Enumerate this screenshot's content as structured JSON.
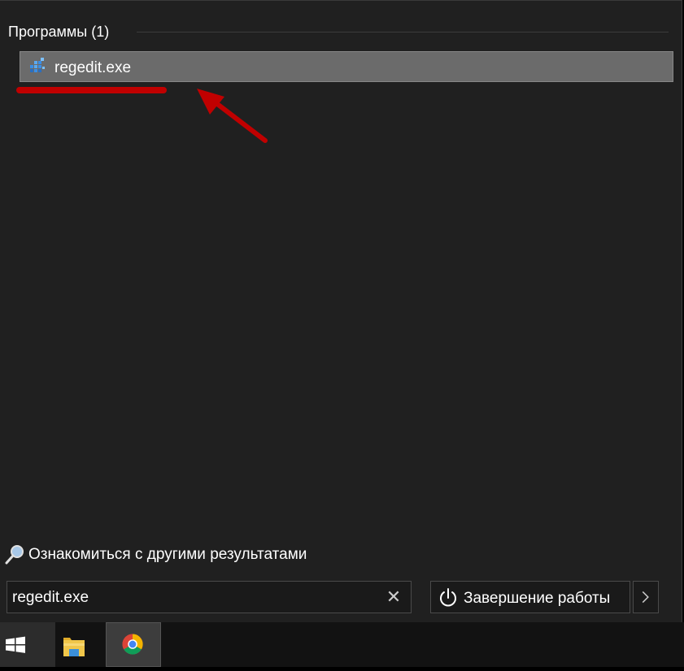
{
  "results": {
    "header": "Программы (1)",
    "items": [
      {
        "label": "regedit.exe",
        "icon": "registry-editor-icon"
      }
    ]
  },
  "more_results": {
    "label": "Ознакомиться с другими результатами",
    "icon": "search-magnifier-icon"
  },
  "search": {
    "value": "regedit.exe",
    "clear_icon": "✕"
  },
  "power": {
    "label": "Завершение работы",
    "icon": "power-icon",
    "more_icon": "chevron-right-icon"
  },
  "taskbar": {
    "items": [
      {
        "name": "windows-start-icon"
      },
      {
        "name": "file-explorer-icon"
      },
      {
        "name": "chrome-icon"
      }
    ]
  },
  "colors": {
    "annotation": "#c00000",
    "panel_bg": "#202020",
    "selected_bg": "#6b6b6b"
  }
}
